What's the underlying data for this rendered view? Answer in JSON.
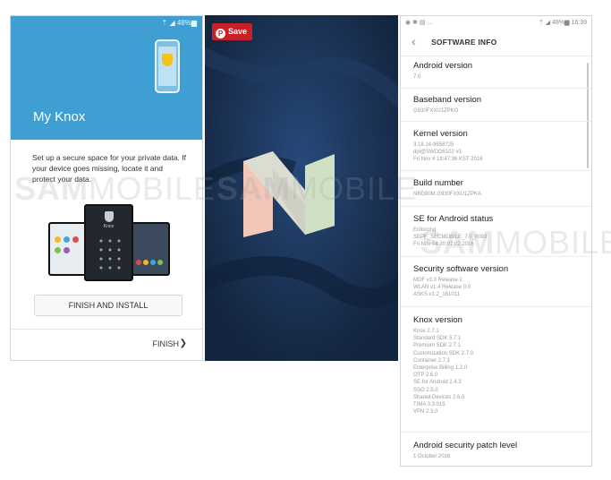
{
  "watermark": {
    "bold": "SAM",
    "thin": "MOBILE"
  },
  "knox": {
    "status": "⇡ ◢ 48%▆",
    "title": "My Knox",
    "description": "Set up a secure space for your private data. If your device goes missing, locate it and protect your data.",
    "device_brand": "Knox",
    "install_button": "FINISH AND INSTALL",
    "finish_button": "FINISH",
    "finish_arrow": "❯",
    "accent_color": "#3f9fd2"
  },
  "nougat": {
    "save_label": "Save",
    "save_icon": "P",
    "background_color": "#1b3353"
  },
  "software_info": {
    "status_left": "◉ ✱ ▤ ...",
    "status_right": "⇡ ◢ 48%▆ 16:39",
    "back_icon": "‹",
    "title": "SOFTWARE INFO",
    "items": [
      {
        "label": "Android version",
        "value": "7.0"
      },
      {
        "label": "Baseband version",
        "value": "G930FXXU1ZPKO"
      },
      {
        "label": "Kernel version",
        "value": "3.18.14-9658725\ndpi@SWDD6102 #1\nFri Nov 4 19:47:36 KST 2016"
      },
      {
        "label": "Build number",
        "value": "NRD90M.G930FXXU1ZPKA"
      },
      {
        "label": "SE for Android status",
        "value": "Enforcing\nSEPF_SECMOBILE_7.0_0003\nFri Nov 04 20:07:02 2016"
      },
      {
        "label": "Security software version",
        "value": "MDF v3.0 Release 1\nWLAN v1.4 Release 0.0\nASKS v1.2_161011"
      },
      {
        "label": "Knox version",
        "value": "Knox 2.7.1\nStandard SDK 5.7.1\nPremium SDK 2.7.1\nCustomization SDK 2.7.0\nContainer 2.7.1\nEnterprise Billing 1.2.0\nOTP 2.6.0\nSE for Android 2.4.3\nSSO 2.5.0\nShared Devices 2.6.0\nTIMA 3.3.015\nVPN 2.3.0"
      },
      {
        "label": "Android security patch level",
        "value": "1 October 2016"
      }
    ]
  }
}
